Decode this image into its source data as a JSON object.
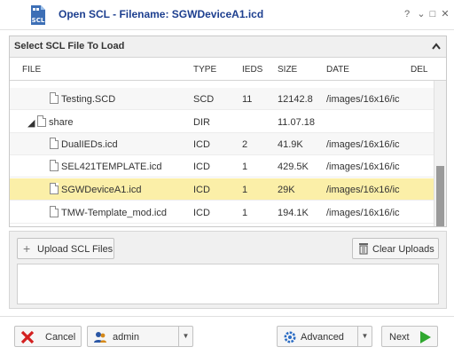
{
  "window": {
    "icon_text": "SCL",
    "title": "Open SCL - Filename: SGWDeviceA1.icd",
    "controls": [
      "?",
      "⌄",
      "□",
      "✕"
    ]
  },
  "panel": {
    "title": "Select SCL File To Load",
    "collapse_icon": "chevron-up"
  },
  "columns": {
    "file": "FILE",
    "type": "TYPE",
    "ieds": "IEDS",
    "size": "SIZE",
    "date": "DATE",
    "del": "DEL"
  },
  "rows": [
    {
      "name": "Testing.SCD",
      "type": "SCD",
      "ieds": "11",
      "size": "12142.8",
      "date": "/images/16x16/ic"
    },
    {
      "name": "share",
      "type": "DIR",
      "ieds": "",
      "size": "11.07.18",
      "date": ""
    },
    {
      "name": "DualIEDs.icd",
      "type": "ICD",
      "ieds": "2",
      "size": "41.9K",
      "date": "/images/16x16/ic"
    },
    {
      "name": "SEL421TEMPLATE.icd",
      "type": "ICD",
      "ieds": "1",
      "size": "429.5K",
      "date": "/images/16x16/ic"
    },
    {
      "name": "SGWDeviceA1.icd",
      "type": "ICD",
      "ieds": "1",
      "size": "29K",
      "date": "/images/16x16/ic"
    },
    {
      "name": "TMW-Template_mod.icd",
      "type": "ICD",
      "ieds": "1",
      "size": "194.1K",
      "date": "/images/16x16/ic"
    }
  ],
  "upload": {
    "upload_label": "Upload SCL Files",
    "clear_label": "Clear Uploads"
  },
  "footer": {
    "cancel_label": "Cancel",
    "user_label": "admin",
    "advanced_label": "Advanced",
    "next_label": "Next"
  },
  "colors": {
    "title_blue": "#1d3f8f",
    "selected_row": "#fbefa8",
    "cancel_red": "#d32020",
    "next_green": "#2fa82f"
  }
}
